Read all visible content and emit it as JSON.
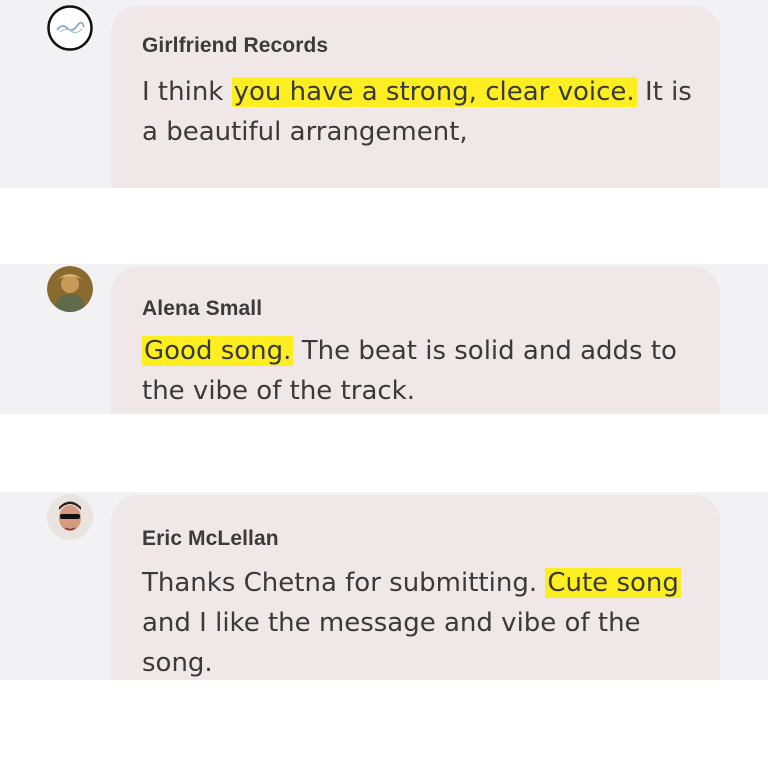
{
  "comments": [
    {
      "author": "Girlfriend Records",
      "avatar_icon": "label-logo-icon",
      "text_before": "I think ",
      "highlight": "you have a strong, clear voice.",
      "text_after": " It is a beautiful arrangement,"
    },
    {
      "author": "Alena Small",
      "avatar_icon": "user-photo-icon",
      "text_before": "",
      "highlight": "Good song.",
      "text_after": " The beat is solid and adds to the vibe of the track."
    },
    {
      "author": "Eric McLellan",
      "avatar_icon": "user-photo-icon",
      "text_before": "Thanks Chetna for submitting. ",
      "highlight": "Cute song",
      "text_after": " and I like the message and vibe of the song."
    }
  ],
  "colors": {
    "highlight": "#fcee21",
    "bubble": "#efe7e8",
    "panel": "#f2f2f4",
    "text": "#3a3a3a"
  }
}
